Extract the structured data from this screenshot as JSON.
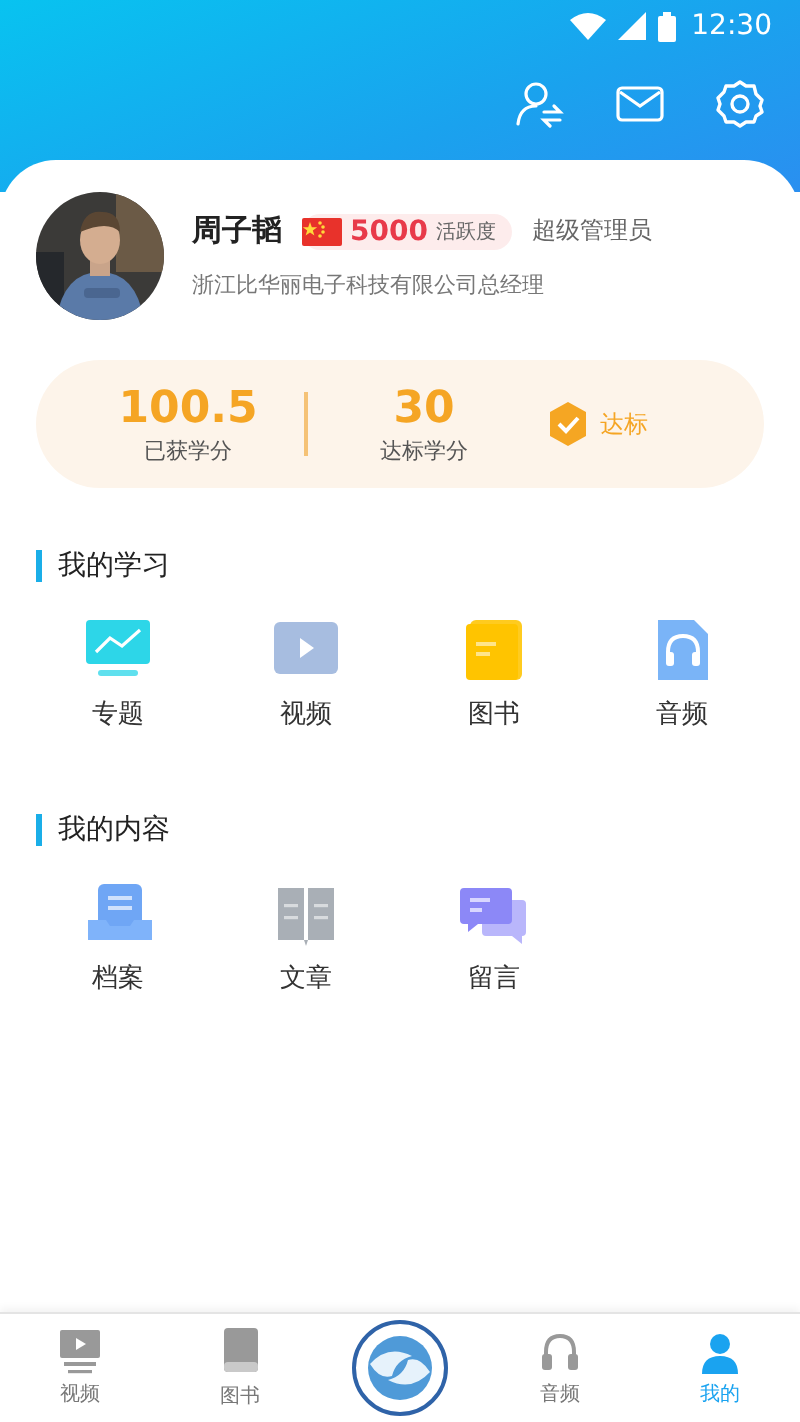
{
  "status_bar": {
    "time": "12:30"
  },
  "profile": {
    "name": "周子韬",
    "score": "5000",
    "score_label": "活跃度",
    "role": "超级管理员",
    "title": "浙江比华丽电子科技有限公司总经理"
  },
  "credits": {
    "earned": "100.5",
    "earned_label": "已获学分",
    "target": "30",
    "target_label": "达标学分",
    "status": "达标",
    "achieved": true
  },
  "sections": [
    {
      "title": "我的学习",
      "items": [
        {
          "kind": "topic",
          "label": "专题"
        },
        {
          "kind": "video",
          "label": "视频"
        },
        {
          "kind": "book",
          "label": "图书"
        },
        {
          "kind": "audio",
          "label": "音频"
        }
      ]
    },
    {
      "title": "我的内容",
      "items": [
        {
          "kind": "archive",
          "label": "档案"
        },
        {
          "kind": "article",
          "label": "文章"
        },
        {
          "kind": "message",
          "label": "留言"
        }
      ]
    }
  ],
  "nav": [
    {
      "kind": "video",
      "label": "视频",
      "selected": false
    },
    {
      "kind": "book",
      "label": "图书",
      "selected": false
    },
    {
      "kind": "logo"
    },
    {
      "kind": "audio",
      "label": "音频",
      "selected": false
    },
    {
      "kind": "me",
      "label": "我的",
      "selected": true
    }
  ]
}
